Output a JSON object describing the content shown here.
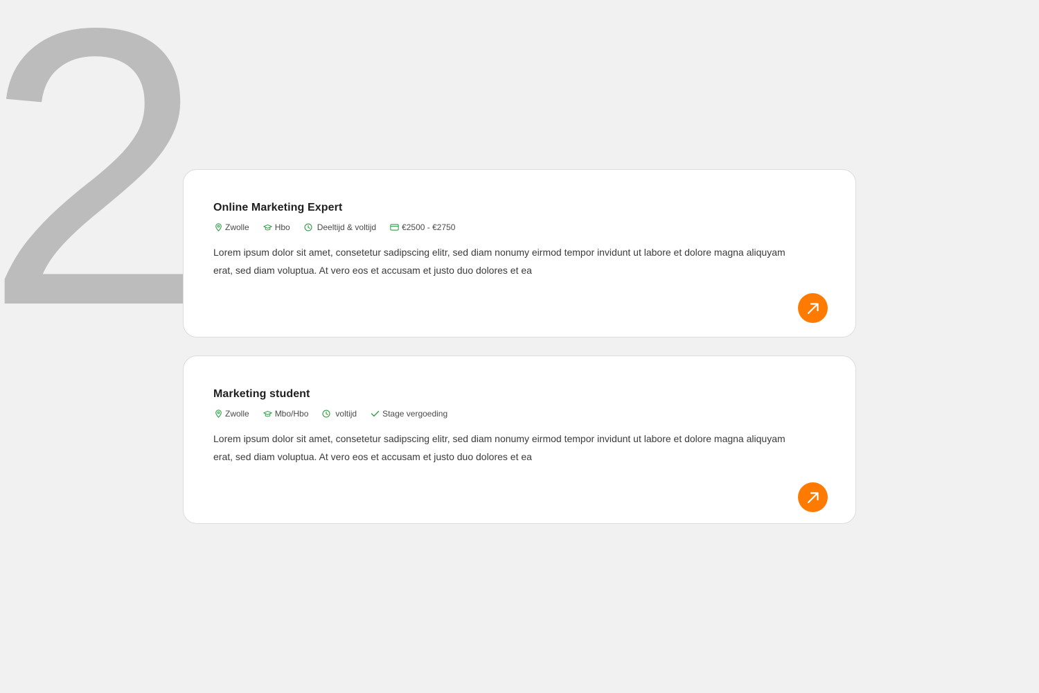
{
  "step_number": "2",
  "colors": {
    "accent": "#ff7a00",
    "icon_green": "#2e9e44",
    "step_number": "#bcbcbc",
    "background": "#f1f1f1"
  },
  "jobs": [
    {
      "title": "Online Marketing Expert",
      "meta": [
        {
          "icon": "location-pin-icon",
          "text": "Zwolle"
        },
        {
          "icon": "graduation-cap-icon",
          "text": "Hbo"
        },
        {
          "icon": "clock-icon",
          "text": "Deeltijd & voltijd"
        },
        {
          "icon": "credit-card-icon",
          "text": "€2500 - €2750"
        }
      ],
      "description": "Lorem ipsum dolor sit amet, consetetur sadipscing elitr, sed diam nonumy eirmod tempor invidunt ut labore et dolore magna aliquyam erat, sed diam voluptua. At vero eos et accusam et justo duo dolores et ea",
      "action_icon": "arrow-up-right-icon"
    },
    {
      "title": "Marketing student",
      "meta": [
        {
          "icon": "location-pin-icon",
          "text": "Zwolle"
        },
        {
          "icon": "graduation-cap-icon",
          "text": "Mbo/Hbo"
        },
        {
          "icon": "clock-icon",
          "text": "voltijd"
        },
        {
          "icon": "checkmark-icon",
          "text": "Stage vergoeding"
        }
      ],
      "description": "Lorem ipsum dolor sit amet, consetetur sadipscing elitr, sed diam nonumy eirmod tempor invidunt ut labore et dolore magna aliquyam erat, sed diam voluptua. At vero eos et accusam et justo duo dolores et ea",
      "action_icon": "arrow-up-right-icon"
    }
  ]
}
